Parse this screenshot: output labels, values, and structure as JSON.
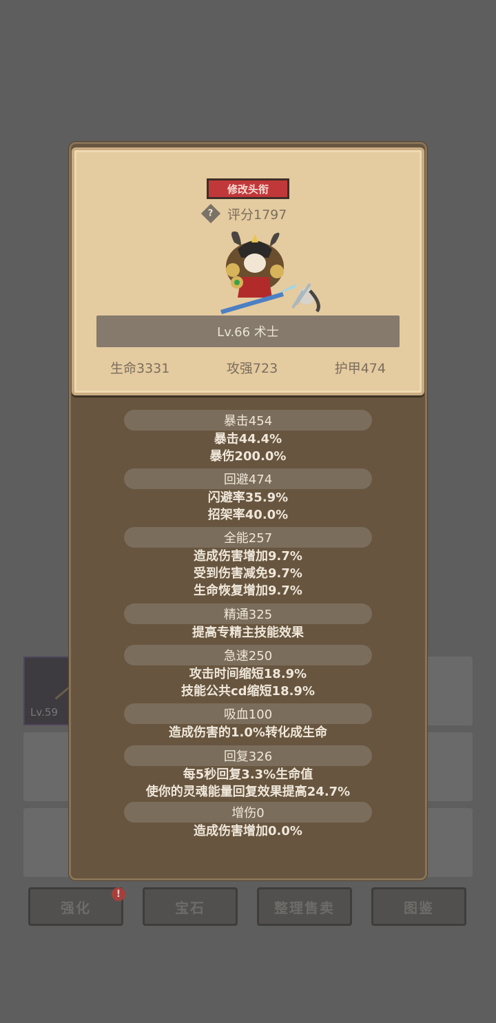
{
  "background": {
    "slot_level": "Lv.59",
    "buttons": [
      "强化",
      "宝石",
      "整理售卖",
      "图鉴"
    ],
    "badge": "!"
  },
  "header": {
    "title_button": "修改头衔",
    "help_icon": "?",
    "score": "评分1797",
    "name_level": "Lv.66 术士",
    "hp": "生命3331",
    "attack": "攻强723",
    "armor": "护甲474"
  },
  "stats": [
    {
      "head": "暴击454",
      "lines": [
        "暴击44.4%",
        "暴伤200.0%"
      ]
    },
    {
      "head": "回避474",
      "lines": [
        "闪避率35.9%",
        "招架率40.0%"
      ]
    },
    {
      "head": "全能257",
      "lines": [
        "造成伤害增加9.7%",
        "受到伤害减免9.7%",
        "生命恢复增加9.7%"
      ]
    },
    {
      "head": "精通325",
      "lines": [
        "提高专精主技能效果"
      ]
    },
    {
      "head": "急速250",
      "lines": [
        "攻击时间缩短18.9%",
        "技能公共cd缩短18.9%"
      ]
    },
    {
      "head": "吸血100",
      "lines": [
        "造成伤害的1.0%转化成生命"
      ]
    },
    {
      "head": "回复326",
      "lines": [
        "每5秒回复3.3%生命值",
        "使你的灵魂能量回复效果提高24.7%"
      ]
    },
    {
      "head": "增伤0",
      "lines": [
        "造成伤害增加0.0%"
      ]
    }
  ]
}
